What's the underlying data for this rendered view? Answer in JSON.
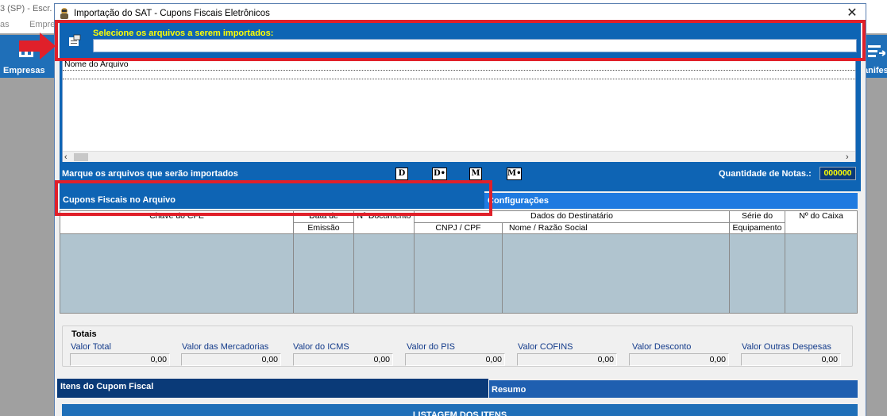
{
  "background": {
    "title_fragment": "3 (SP) - Escr.",
    "menu_items": [
      "as",
      "Empresa"
    ],
    "toolbar_left_label": "Empresas",
    "toolbar_right_label": "anifes"
  },
  "dialog": {
    "title": "Importação do SAT - Cupons Fiscais Eletrônicos",
    "close_glyph": "✕",
    "select_label": "Selecione os arquivos a serem importados:",
    "select_value": "",
    "file_list_header": "Nome do Arquivo",
    "mark_label": "Marque os arquivos que serão importados",
    "filter_buttons": [
      "D",
      "D•",
      "M",
      "M•"
    ],
    "qty_label": "Quantidade de Notas.:",
    "qty_value": "000000"
  },
  "tabs": {
    "cupons": "Cupons Fiscais no Arquivo",
    "configuracoes": "Configurações"
  },
  "grid": {
    "chave": "Chave do CFE",
    "data_line1": "Data de",
    "data_line2": "Emissão",
    "documento": "Nº Documento",
    "destinatario": "Dados do Destinatário",
    "cnpj": "CNPJ / CPF",
    "nome": "Nome / Razão Social",
    "serie_line1": "Série do",
    "serie_line2": "Equipamento",
    "caixa": "Nº do Caixa"
  },
  "totals": {
    "legend": "Totais",
    "fields": [
      {
        "label": "Valor Total",
        "value": "0,00"
      },
      {
        "label": "Valor das Mercadorias",
        "value": "0,00"
      },
      {
        "label": "Valor do ICMS",
        "value": "0,00"
      },
      {
        "label": "Valor do PIS",
        "value": "0,00"
      },
      {
        "label": "Valor COFINS",
        "value": "0,00"
      },
      {
        "label": "Valor Desconto",
        "value": "0,00"
      },
      {
        "label": "Valor Outras Despesas",
        "value": "0,00"
      }
    ]
  },
  "bottom_tabs": {
    "itens": "Itens do Cupom Fiscal",
    "resumo": "Resumo",
    "listagem": "LISTAGEM DOS ITENS"
  },
  "colors": {
    "panel_blue": "#0e64b4",
    "highlight_yellow": "#ffff00",
    "annotation_red": "#e0202a"
  }
}
